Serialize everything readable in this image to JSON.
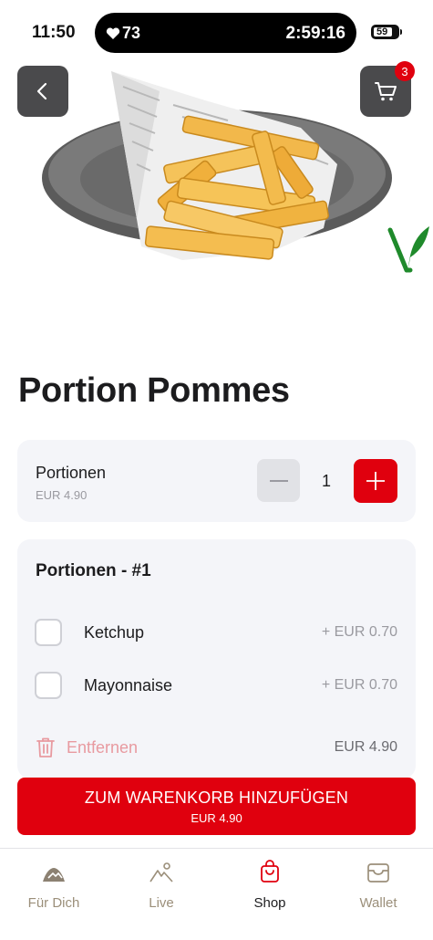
{
  "status_bar": {
    "time": "11:50",
    "heart_rate": "73",
    "timer": "2:59:16",
    "battery": "59"
  },
  "header": {
    "cart_count": "3"
  },
  "product": {
    "title": "Portion Pommes",
    "image_icon": "french-fries-image",
    "vegan_icon": "vegan-leaf-icon"
  },
  "portion": {
    "label": "Portionen",
    "price": "EUR 4.90",
    "quantity": "1"
  },
  "options": {
    "title": "Portionen - #1",
    "items": [
      {
        "label": "Ketchup",
        "price": "+ EUR 0.70",
        "checked": false
      },
      {
        "label": "Mayonnaise",
        "price": "+ EUR 0.70",
        "checked": false
      }
    ],
    "remove_label": "Entfernen",
    "total": "EUR 4.90"
  },
  "cta": {
    "label": "ZUM WARENKORB HINZUFÜGEN",
    "price": "EUR 4.90"
  },
  "tabs": [
    {
      "label": "Für Dich",
      "icon": "mountain-icon",
      "active": false
    },
    {
      "label": "Live",
      "icon": "mountain-sun-icon",
      "active": false
    },
    {
      "label": "Shop",
      "icon": "shopping-bag-icon",
      "active": true
    },
    {
      "label": "Wallet",
      "icon": "wallet-icon",
      "active": false
    }
  ],
  "colors": {
    "accent": "#e0000e",
    "card_bg": "#f4f5f9",
    "tab_inactive": "#9b8f7a",
    "vegan_green": "#1f8a2b"
  }
}
